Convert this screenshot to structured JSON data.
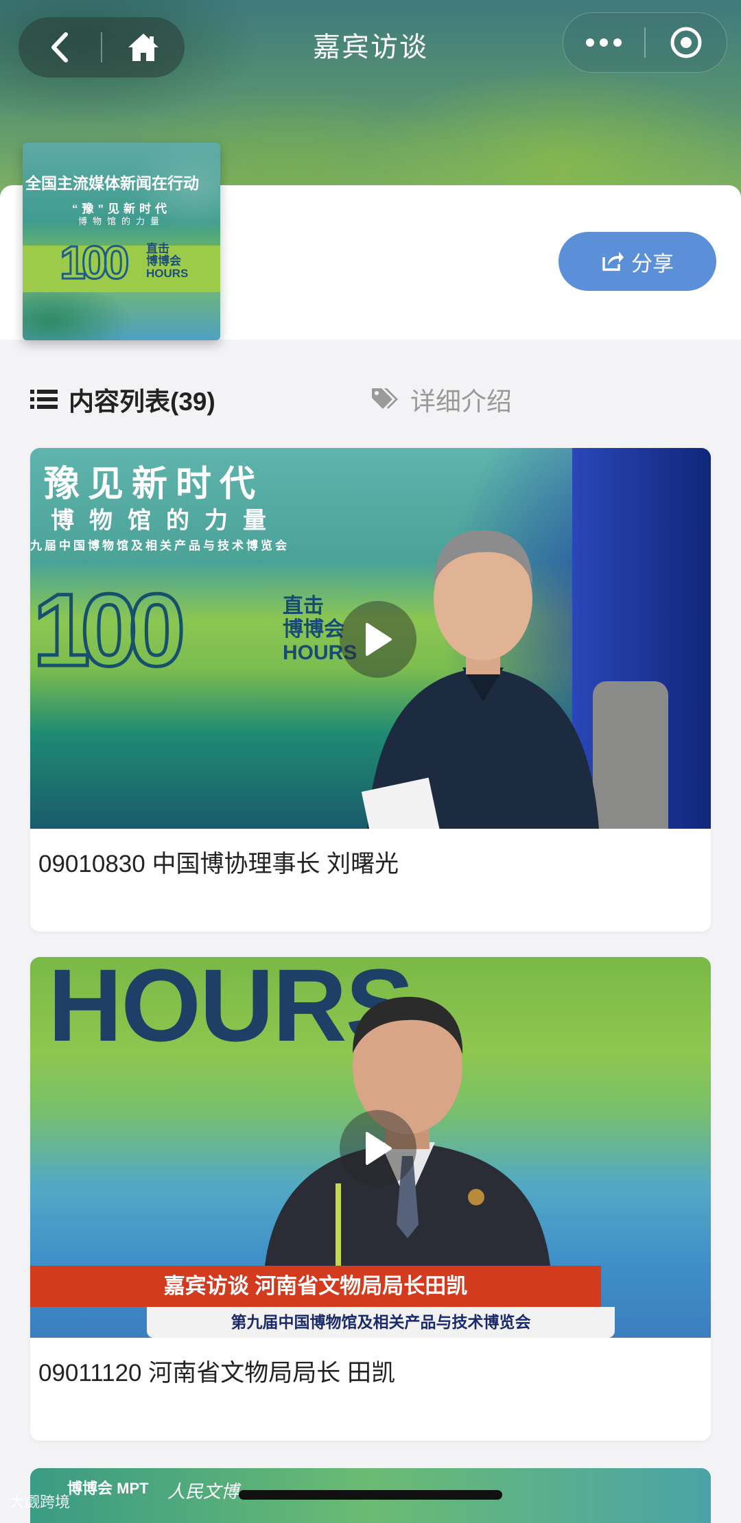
{
  "header": {
    "title": "嘉宾访谈"
  },
  "program": {
    "cover": {
      "line1": "全国主流媒体新闻在行动",
      "line2": "“豫”见新时代",
      "line3": "博物馆的力量",
      "number": "100",
      "side_label": "直击\n博博会",
      "hours": "HOURS"
    },
    "share_label": "分享"
  },
  "tabs": {
    "list_label": "内容列表(39)",
    "detail_label": "详细介绍"
  },
  "videos": [
    {
      "title": "09010830 中国博协理事长 刘曙光",
      "thumb": {
        "head1": "豫见新时代",
        "head2": "博物馆的力量",
        "head3": "九届中国博物馆及相关产品与技术博览会",
        "number": "100",
        "side": "直击\n博博会\nHOURS"
      }
    },
    {
      "title": "09011120 河南省文物局局长 田凯",
      "thumb": {
        "hours": "HOURS",
        "caption": "嘉宾访谈 河南省文物局局长田凯",
        "subcaption": "第九届中国博物馆及相关产品与技术博览会"
      }
    }
  ],
  "third_card": {
    "logo_left": "博博会 MPT",
    "logo_right": "人民文博"
  },
  "watermark": "大觑跨境",
  "colors": {
    "share_button": "#5b8fd8",
    "red_banner": "#d23b1e"
  }
}
